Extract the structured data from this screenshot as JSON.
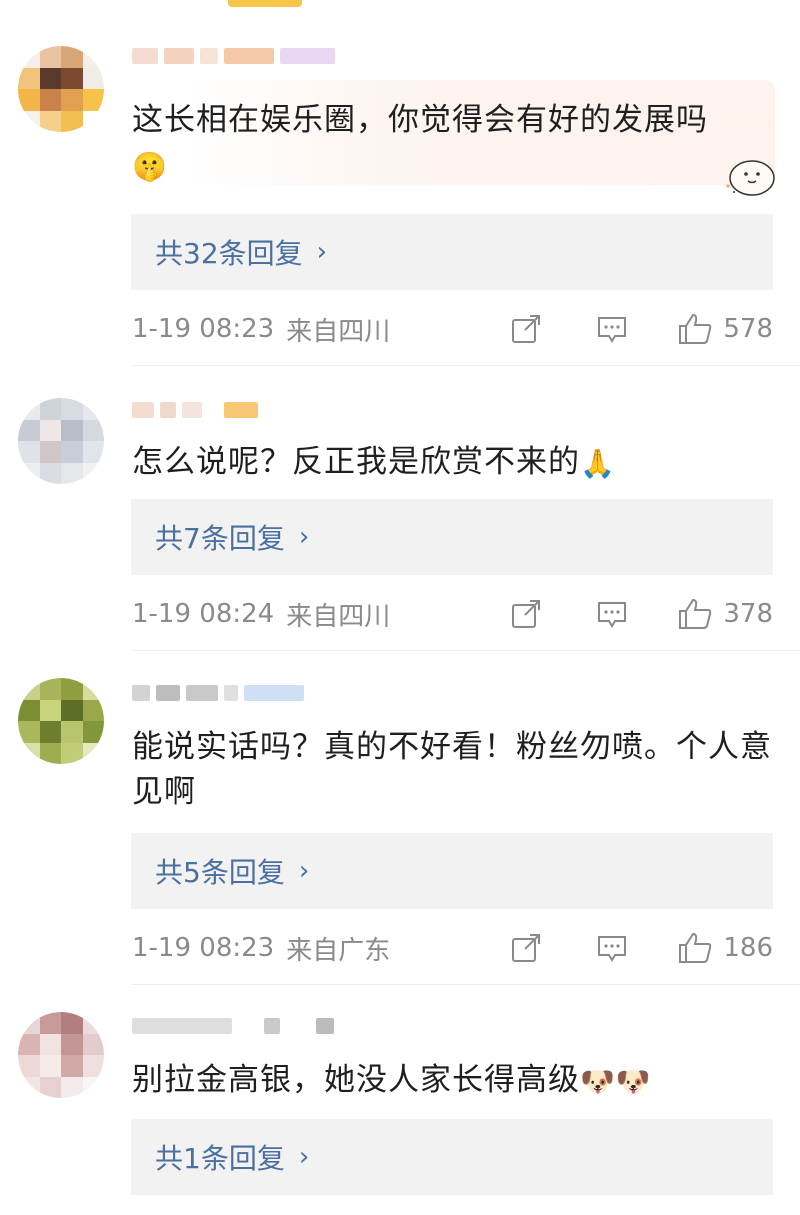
{
  "comments": [
    {
      "text": "这长相在娱乐圈，你觉得会有好的发展吗",
      "emoji": "🤫",
      "reply_label": "共32条回复",
      "time": "1-19 08:23",
      "location": "来自四川",
      "likes": "578"
    },
    {
      "text": "怎么说呢？反正我是欣赏不来的",
      "emoji": "🙏",
      "reply_label": "共7条回复",
      "time": "1-19 08:24",
      "location": "来自四川",
      "likes": "378"
    },
    {
      "text": "能说实话吗？真的不好看！粉丝勿喷。个人意见啊",
      "emoji": "",
      "reply_label": "共5条回复",
      "time": "1-19 08:23",
      "location": "来自广东",
      "likes": "186"
    },
    {
      "text": "别拉金高银，她没人家长得高级",
      "emoji": "🐶🐶",
      "reply_label": "共1条回复",
      "time": "",
      "location": "",
      "likes": ""
    }
  ],
  "icons": {
    "share": "share-icon",
    "comment": "comment-icon",
    "like": "thumbs-up-icon",
    "chevron": "chevron-right-icon"
  },
  "colors": {
    "reply_link": "#4a6fa1",
    "reply_bg": "#f2f2f2",
    "meta": "#8a8a8a"
  },
  "chevron": "›"
}
